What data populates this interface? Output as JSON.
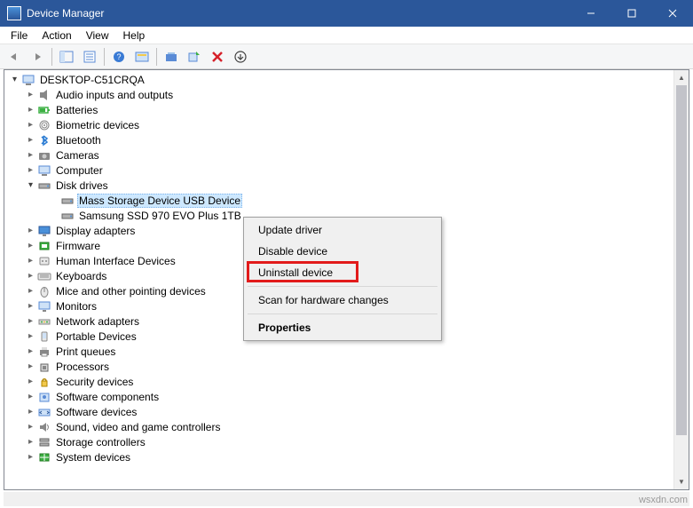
{
  "window": {
    "title": "Device Manager"
  },
  "menu": {
    "file": "File",
    "action": "Action",
    "view": "View",
    "help": "Help"
  },
  "toolbar": {
    "back": "back-icon",
    "forward": "forward-icon",
    "show_hide_tree": "show-hide-console-tree-icon",
    "properties": "properties-icon",
    "help": "help-icon",
    "action_center": "action-icon",
    "update": "update-driver-icon",
    "scan": "scan-hardware-icon",
    "uninstall_x": "uninstall-icon",
    "add_legacy": "add-legacy-icon"
  },
  "tree": {
    "root": "DESKTOP-C51CRQA",
    "nodes": [
      {
        "label": "Audio inputs and outputs",
        "depth": 1,
        "exp": "closed",
        "icon": "audio"
      },
      {
        "label": "Batteries",
        "depth": 1,
        "exp": "closed",
        "icon": "battery"
      },
      {
        "label": "Biometric devices",
        "depth": 1,
        "exp": "closed",
        "icon": "biometric"
      },
      {
        "label": "Bluetooth",
        "depth": 1,
        "exp": "closed",
        "icon": "bluetooth"
      },
      {
        "label": "Cameras",
        "depth": 1,
        "exp": "closed",
        "icon": "camera"
      },
      {
        "label": "Computer",
        "depth": 1,
        "exp": "closed",
        "icon": "computer"
      },
      {
        "label": "Disk drives",
        "depth": 1,
        "exp": "open",
        "icon": "disk"
      },
      {
        "label": "Mass Storage Device USB Device",
        "depth": 2,
        "exp": "none",
        "icon": "disk",
        "selected": true
      },
      {
        "label": "Samsung SSD 970 EVO Plus 1TB",
        "depth": 2,
        "exp": "none",
        "icon": "disk"
      },
      {
        "label": "Display adapters",
        "depth": 1,
        "exp": "closed",
        "icon": "display"
      },
      {
        "label": "Firmware",
        "depth": 1,
        "exp": "closed",
        "icon": "firmware"
      },
      {
        "label": "Human Interface Devices",
        "depth": 1,
        "exp": "closed",
        "icon": "hid"
      },
      {
        "label": "Keyboards",
        "depth": 1,
        "exp": "closed",
        "icon": "keyboard"
      },
      {
        "label": "Mice and other pointing devices",
        "depth": 1,
        "exp": "closed",
        "icon": "mouse"
      },
      {
        "label": "Monitors",
        "depth": 1,
        "exp": "closed",
        "icon": "monitor"
      },
      {
        "label": "Network adapters",
        "depth": 1,
        "exp": "closed",
        "icon": "network"
      },
      {
        "label": "Portable Devices",
        "depth": 1,
        "exp": "closed",
        "icon": "portable"
      },
      {
        "label": "Print queues",
        "depth": 1,
        "exp": "closed",
        "icon": "printer"
      },
      {
        "label": "Processors",
        "depth": 1,
        "exp": "closed",
        "icon": "cpu"
      },
      {
        "label": "Security devices",
        "depth": 1,
        "exp": "closed",
        "icon": "security"
      },
      {
        "label": "Software components",
        "depth": 1,
        "exp": "closed",
        "icon": "softcomp"
      },
      {
        "label": "Software devices",
        "depth": 1,
        "exp": "closed",
        "icon": "softdev"
      },
      {
        "label": "Sound, video and game controllers",
        "depth": 1,
        "exp": "closed",
        "icon": "sound"
      },
      {
        "label": "Storage controllers",
        "depth": 1,
        "exp": "closed",
        "icon": "storage"
      },
      {
        "label": "System devices",
        "depth": 1,
        "exp": "closed",
        "icon": "system"
      }
    ]
  },
  "context_menu": {
    "update": "Update driver",
    "disable": "Disable device",
    "uninstall": "Uninstall device",
    "scan": "Scan for hardware changes",
    "properties": "Properties"
  },
  "watermark": "wsxdn.com"
}
